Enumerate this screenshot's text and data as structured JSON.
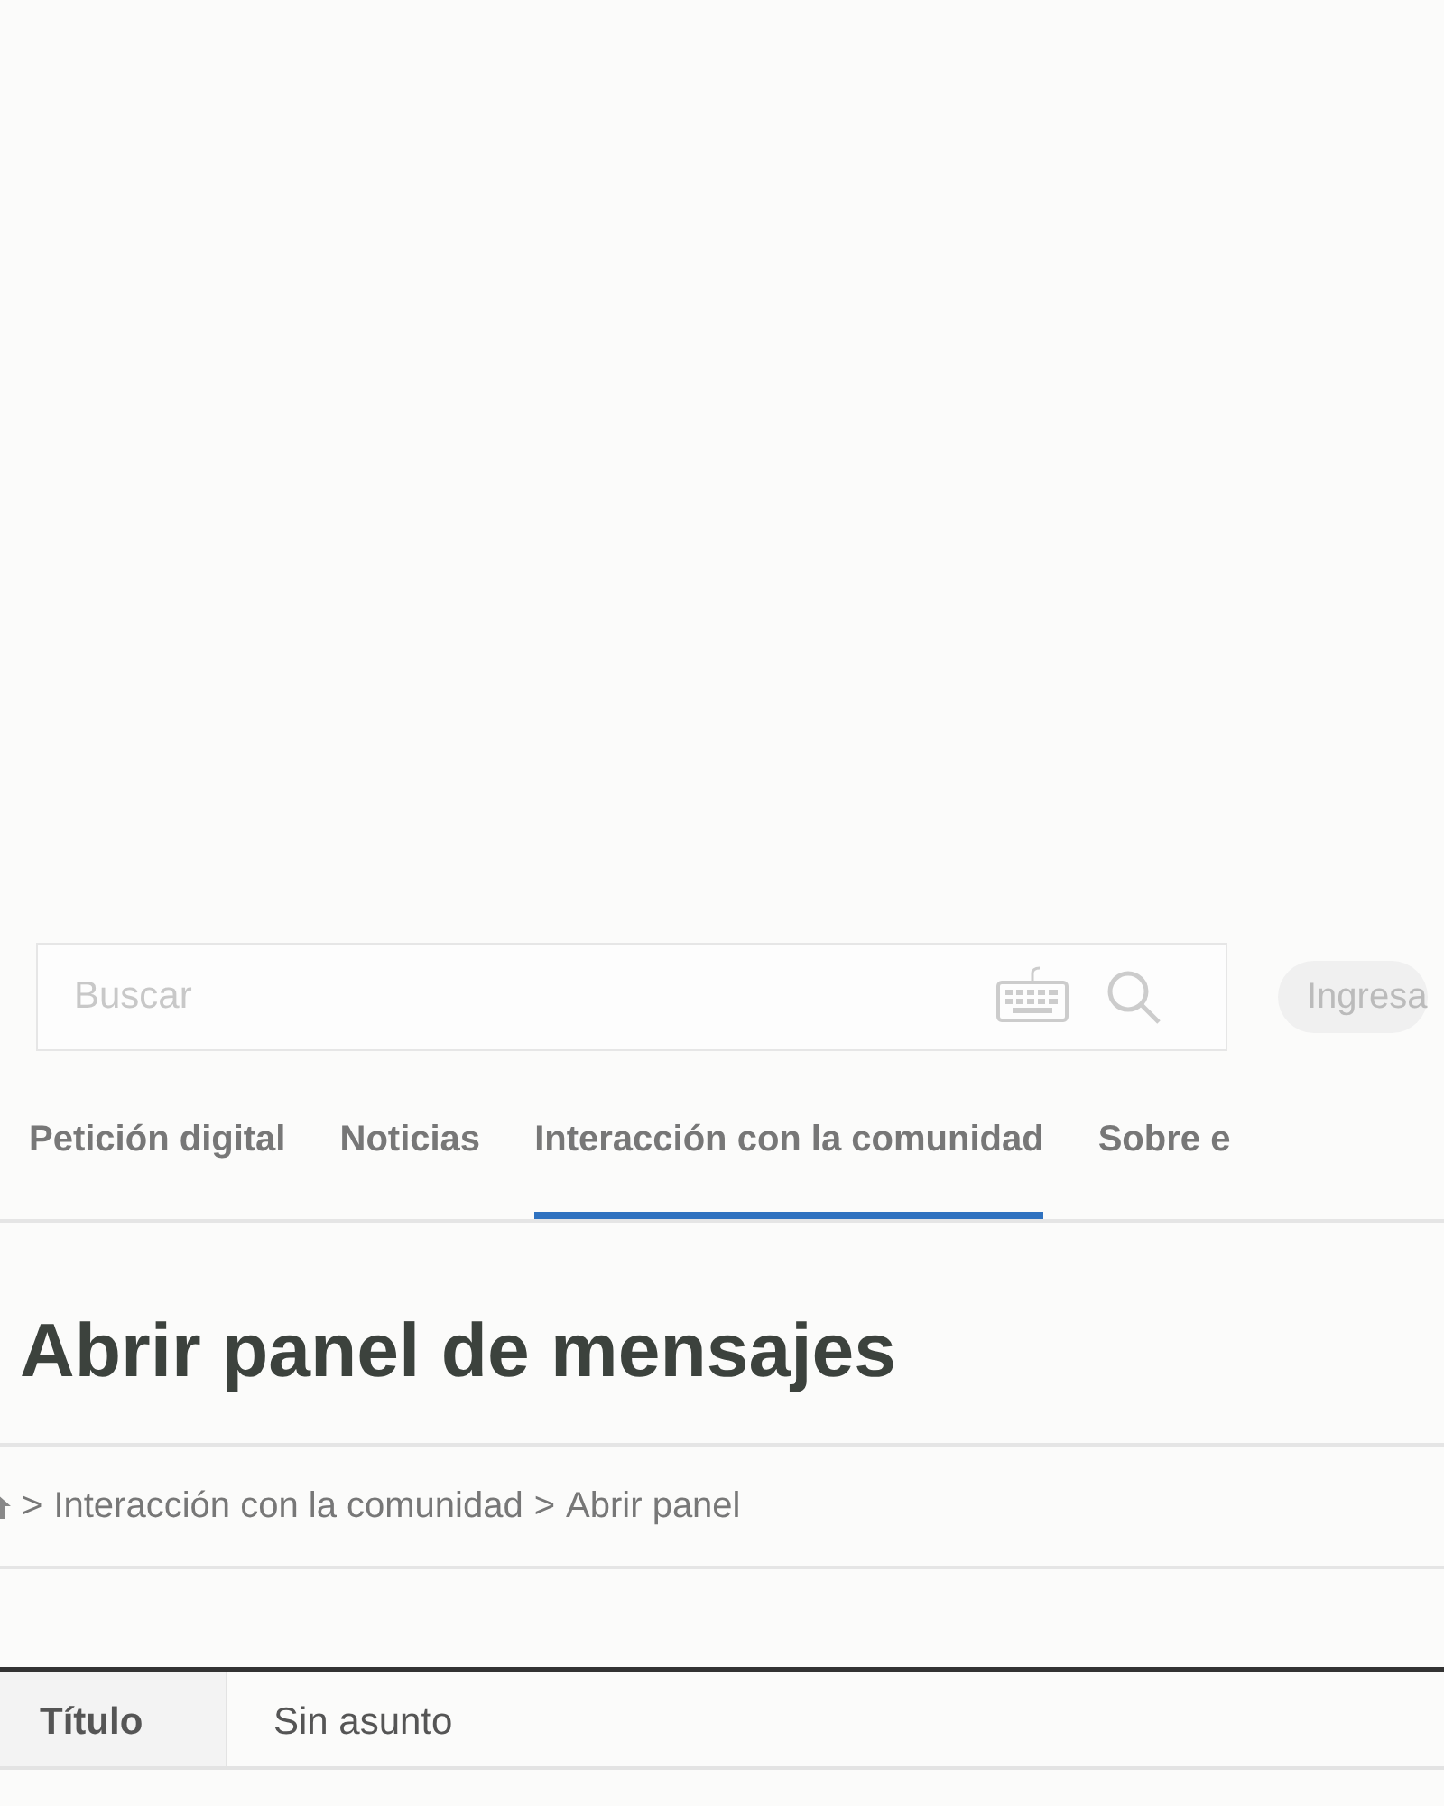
{
  "search": {
    "placeholder": "Buscar"
  },
  "login_button": {
    "label": "Ingresa"
  },
  "nav": [
    {
      "label": "Petición digital",
      "selected": false
    },
    {
      "label": "Noticias",
      "selected": false
    },
    {
      "label": "Interacción con la comunidad",
      "selected": true
    },
    {
      "label": "Sobre e",
      "selected": false
    }
  ],
  "page_title": "Abrir panel de mensajes",
  "breadcrumb": [
    {
      "label": "Interacción con la comunidad"
    },
    {
      "label": "Abrir panel"
    }
  ],
  "breadcrumb_separator": ">",
  "details": [
    {
      "label": "Título",
      "value": "Sin asunto"
    }
  ]
}
